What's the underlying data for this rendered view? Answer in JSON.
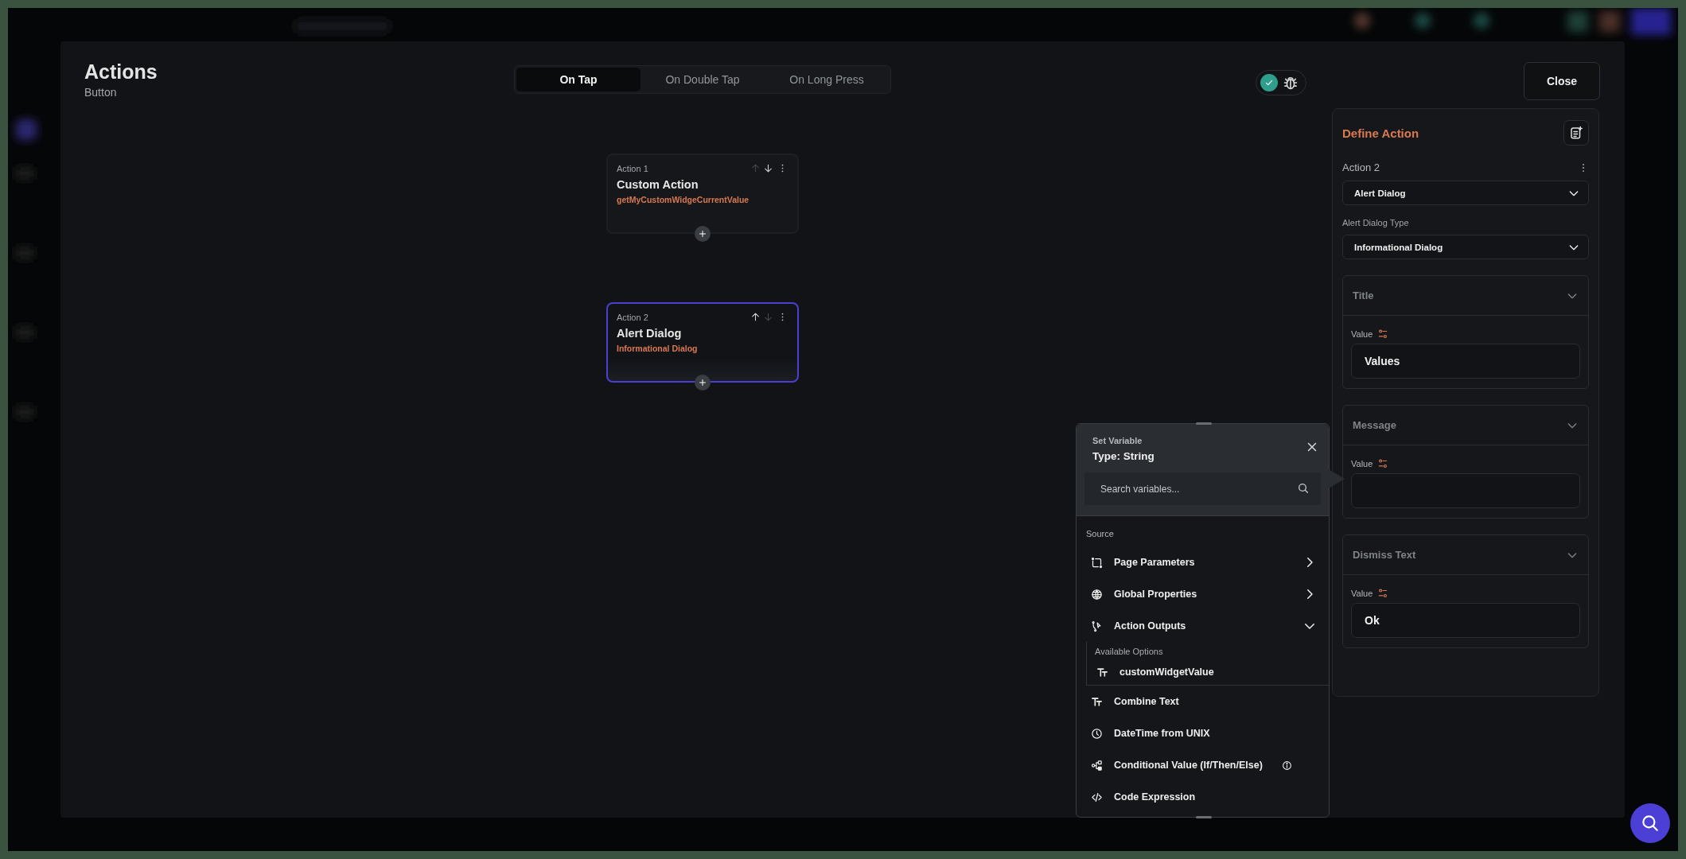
{
  "header": {
    "title": "Actions",
    "subtitle": "Button"
  },
  "tabs": [
    {
      "label": "On Tap",
      "selected": true
    },
    {
      "label": "On Double Tap",
      "selected": false
    },
    {
      "label": "On Long Press",
      "selected": false
    }
  ],
  "status": {
    "passed": true
  },
  "close_button": "Close",
  "actions": [
    {
      "label": "Action 1",
      "name": "Custom Action",
      "detail": "getMyCustomWidgeCurrentValue",
      "selected": false,
      "up_enabled": false,
      "down_enabled": true
    },
    {
      "label": "Action 2",
      "name": "Alert Dialog",
      "detail": "Informational Dialog",
      "selected": true,
      "up_enabled": true,
      "down_enabled": false
    }
  ],
  "panel": {
    "title": "Define Action",
    "action_label": "Action 2",
    "action_type": "Alert Dialog",
    "dialog_type_label": "Alert Dialog Type",
    "dialog_type": "Informational Dialog",
    "sections": [
      {
        "title": "Title",
        "value_label": "Value",
        "value": "Values"
      },
      {
        "title": "Message",
        "value_label": "Value"
      },
      {
        "title": "Dismiss Text",
        "value_label": "Value",
        "value": "Ok"
      }
    ]
  },
  "variable_popup": {
    "title": "Set Variable",
    "type": "Type: String",
    "search": {
      "placeholder": "Search variables..."
    },
    "section_label": "Source",
    "sources": [
      {
        "kind": "group",
        "label": "Page Parameters",
        "expanded": false
      },
      {
        "kind": "group",
        "label": "Global Properties",
        "expanded": false
      },
      {
        "kind": "group",
        "label": "Action Outputs",
        "expanded": true,
        "options_label": "Available Options",
        "options": [
          {
            "label": "customWidgetValue"
          }
        ]
      },
      {
        "kind": "item",
        "label": "Combine Text"
      },
      {
        "kind": "item",
        "label": "DateTime from UNIX"
      },
      {
        "kind": "item",
        "label": "Conditional Value (If/Then/Else)",
        "info": true
      },
      {
        "kind": "item",
        "label": "Code Expression"
      }
    ]
  }
}
